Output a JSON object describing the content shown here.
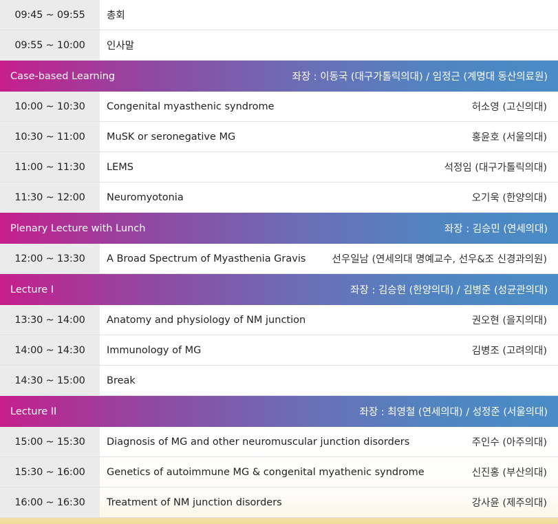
{
  "rows": [
    {
      "time": "09:45 ~ 09:55",
      "title": "총회",
      "speaker": ""
    },
    {
      "time": "09:55 ~ 10:00",
      "title": "인사말",
      "speaker": ""
    }
  ],
  "sessions": [
    {
      "name": "Case-based Learning",
      "chair": "좌장 : 이동국 (대구가톨릭의대) / 임정근 (계명대 동산의료원)",
      "rows": [
        {
          "time": "10:00 ~ 10:30",
          "title": "Congenital myasthenic syndrome",
          "speaker": "허소영 (고신의대)"
        },
        {
          "time": "10:30 ~ 11:00",
          "title": "MuSK or seronegative MG",
          "speaker": "홍윤호 (서울의대)"
        },
        {
          "time": "11:00 ~ 11:30",
          "title": "LEMS",
          "speaker": "석정임 (대구가톨릭의대)"
        },
        {
          "time": "11:30 ~ 12:00",
          "title": "Neuromyotonia",
          "speaker": "오기욱 (한양의대)"
        }
      ]
    },
    {
      "name": "Plenary Lecture with Lunch",
      "chair": "좌장 : 김승민 (연세의대)",
      "rows": [
        {
          "time": "12:00 ~ 13:30",
          "title": "A Broad Spectrum of Myasthenia Gravis",
          "speaker": "선우일남 (연세의대 명예교수, 선우&조 신경과의원)"
        }
      ]
    },
    {
      "name": "Lecture I",
      "chair": "좌장 : 김승현 (한양의대) / 김병준 (성균관의대)",
      "rows": [
        {
          "time": "13:30 ~ 14:00",
          "title": "Anatomy and physiology of NM junction",
          "speaker": "권오현 (을지의대)"
        },
        {
          "time": "14:00 ~ 14:30",
          "title": "Immunology of MG",
          "speaker": "김병조 (고려의대)"
        },
        {
          "time": "14:30 ~ 15:00",
          "title": "Break",
          "speaker": ""
        }
      ]
    },
    {
      "name": "Lecture II",
      "chair": "좌장 : 최영철 (연세의대) / 성정준 (서울의대)",
      "rows": [
        {
          "time": "15:00 ~ 15:30",
          "title": "Diagnosis of MG and other neuromuscular junction disorders",
          "speaker": "주인수 (아주의대)"
        },
        {
          "time": "15:30 ~ 16:00",
          "title": "Genetics of autoimmune MG & congenital myathenic syndrome",
          "speaker": "신진홍 (부산의대)"
        },
        {
          "time": "16:00 ~ 16:30",
          "title": "Treatment of NM junction disorders",
          "speaker": "강사윤 (제주의대)"
        }
      ]
    }
  ],
  "colors": {
    "session_gradient_start": "#c51f8c",
    "session_gradient_end": "#4a8cc6",
    "time_cell_bg": "#ebebeb"
  }
}
